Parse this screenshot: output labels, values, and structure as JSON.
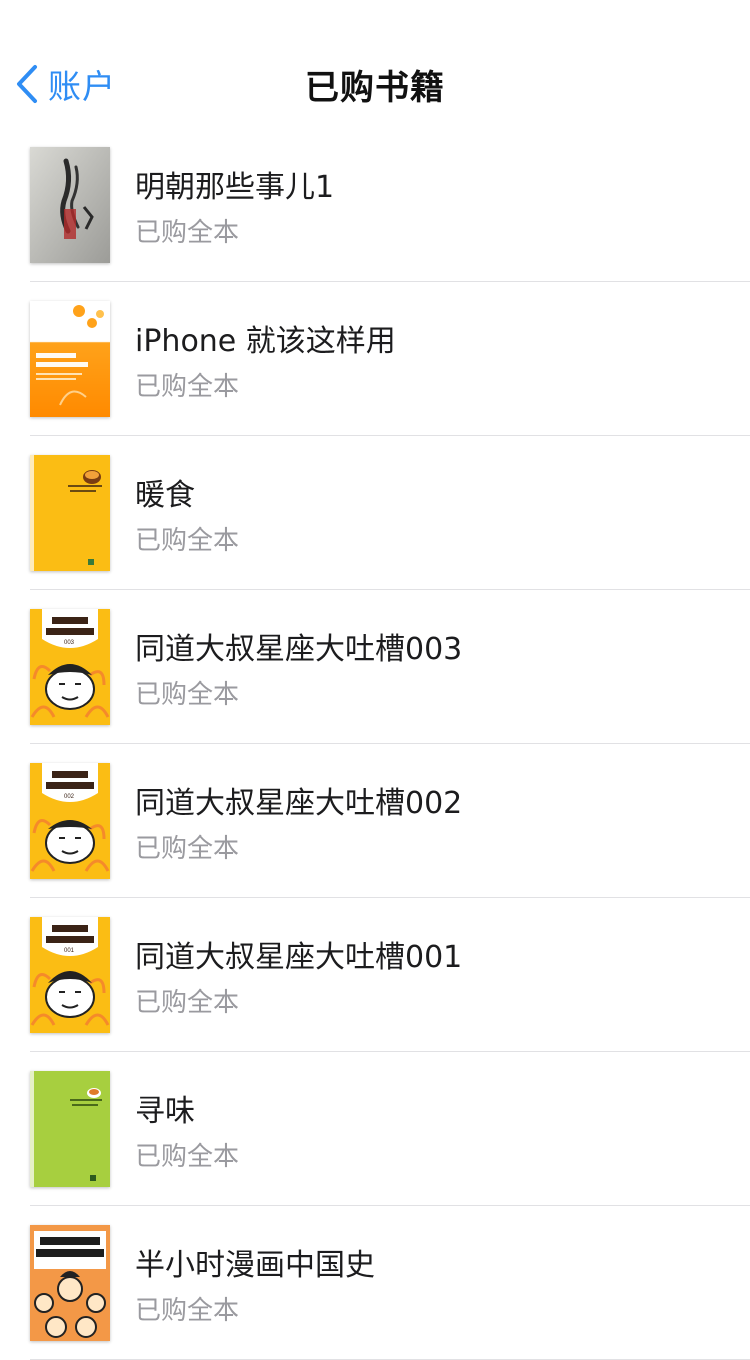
{
  "nav": {
    "back_label": "账户",
    "title": "已购书籍"
  },
  "colors": {
    "accent": "#2f8df4",
    "divider": "#e1e1e4",
    "subtitle": "#9a9a9f"
  },
  "books": [
    {
      "title": "明朝那些事儿1",
      "status": "已购全本",
      "cover_label": "明朝那些事儿"
    },
    {
      "title": "iPhone 就该这样用",
      "status": "已购全本",
      "cover_label": "iPhone就该这样用"
    },
    {
      "title": "暖食",
      "status": "已购全本",
      "cover_label": "暖食"
    },
    {
      "title": "同道大叔星座大吐槽003",
      "status": "已购全本",
      "cover_label": "星座大吐槽"
    },
    {
      "title": "同道大叔星座大吐槽002",
      "status": "已购全本",
      "cover_label": "星座大吐槽"
    },
    {
      "title": "同道大叔星座大吐槽001",
      "status": "已购全本",
      "cover_label": "星座大吐槽"
    },
    {
      "title": "寻味",
      "status": "已购全本",
      "cover_label": "寻味"
    },
    {
      "title": "半小时漫画中国史",
      "status": "已购全本",
      "cover_label": "半小时漫画中国史"
    }
  ]
}
